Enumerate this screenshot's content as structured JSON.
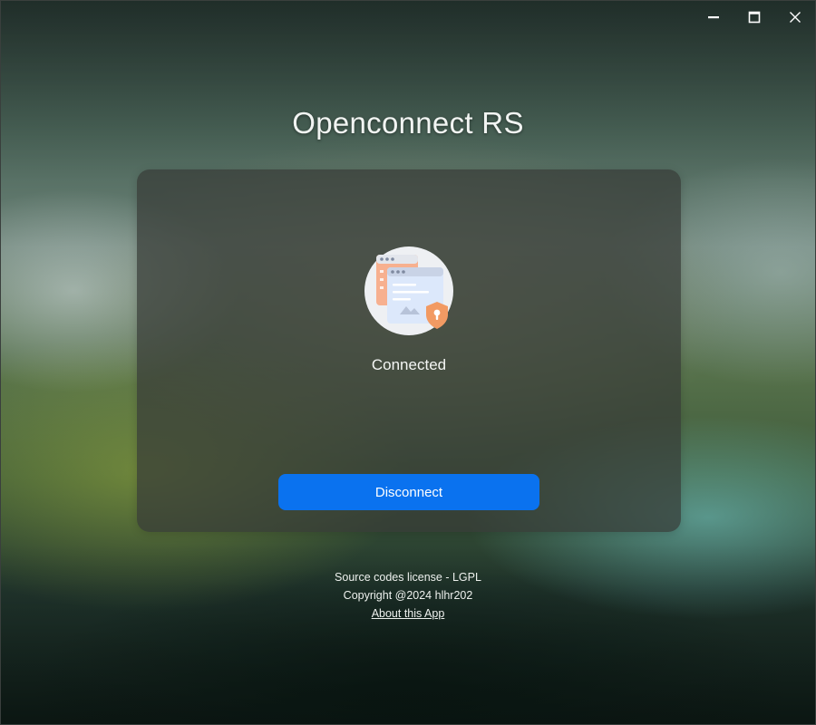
{
  "app": {
    "title": "Openconnect RS"
  },
  "window_controls": {
    "minimize_icon": "minimize-icon",
    "maximize_icon": "maximize-icon",
    "close_icon": "close-icon"
  },
  "status": {
    "icon": "vpn-shield-browser-icon",
    "text": "Connected"
  },
  "actions": {
    "disconnect_label": "Disconnect"
  },
  "footer": {
    "license": "Source codes license - LGPL",
    "copyright": "Copyright @2024 hlhr202",
    "about_link": "About this App"
  },
  "colors": {
    "primary_button": "#0a72ef",
    "card_background": "#373c37",
    "shield": "#f29a63"
  }
}
